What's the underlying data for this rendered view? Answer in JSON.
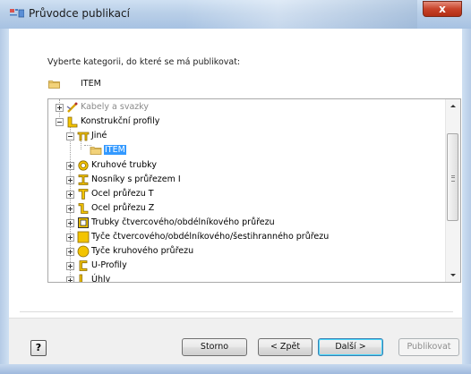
{
  "window": {
    "title": "Průvodce publikací",
    "close_label": "x"
  },
  "prompt": "Vyberte kategorii, do které se má publikovat:",
  "selected_category": "ITEM",
  "tree": {
    "items": [
      {
        "label": "Kabely a svazky",
        "icon": "cable-icon",
        "state": "collapsed",
        "dimmed": true
      },
      {
        "label": "Konstrukční profily",
        "icon": "profile-folder-icon",
        "state": "expanded"
      },
      {
        "label": "Jiné",
        "icon": "profile-pi-icon",
        "state": "expanded"
      },
      {
        "label": "ITEM",
        "icon": "folder-icon",
        "state": "leaf",
        "selected": true
      },
      {
        "label": "Kruhové trubky",
        "icon": "round-tube-icon",
        "state": "collapsed"
      },
      {
        "label": "Nosníky s průřezem I",
        "icon": "i-beam-icon",
        "state": "collapsed"
      },
      {
        "label": "Ocel průřezu T",
        "icon": "t-profile-icon",
        "state": "collapsed"
      },
      {
        "label": "Ocel průřezu Z",
        "icon": "z-profile-icon",
        "state": "collapsed"
      },
      {
        "label": "Trubky čtvercového/obdélníkového průřezu",
        "icon": "square-tube-icon",
        "state": "collapsed"
      },
      {
        "label": "Tyče čtvercového/obdélníkového/šestihranného průřezu",
        "icon": "square-bar-icon",
        "state": "collapsed"
      },
      {
        "label": "Tyče kruhového průřezu",
        "icon": "round-bar-icon",
        "state": "collapsed"
      },
      {
        "label": "U-Profily",
        "icon": "u-profile-icon",
        "state": "collapsed"
      },
      {
        "label": "Úhly",
        "icon": "angle-profile-icon",
        "state": "collapsed"
      }
    ]
  },
  "buttons": {
    "help": "?",
    "cancel": "Storno",
    "back": "< Zpět",
    "next": "Další >",
    "publish": "Publikovat"
  },
  "colors": {
    "selection": "#3399ff",
    "profile_yellow": "#f3c400"
  }
}
